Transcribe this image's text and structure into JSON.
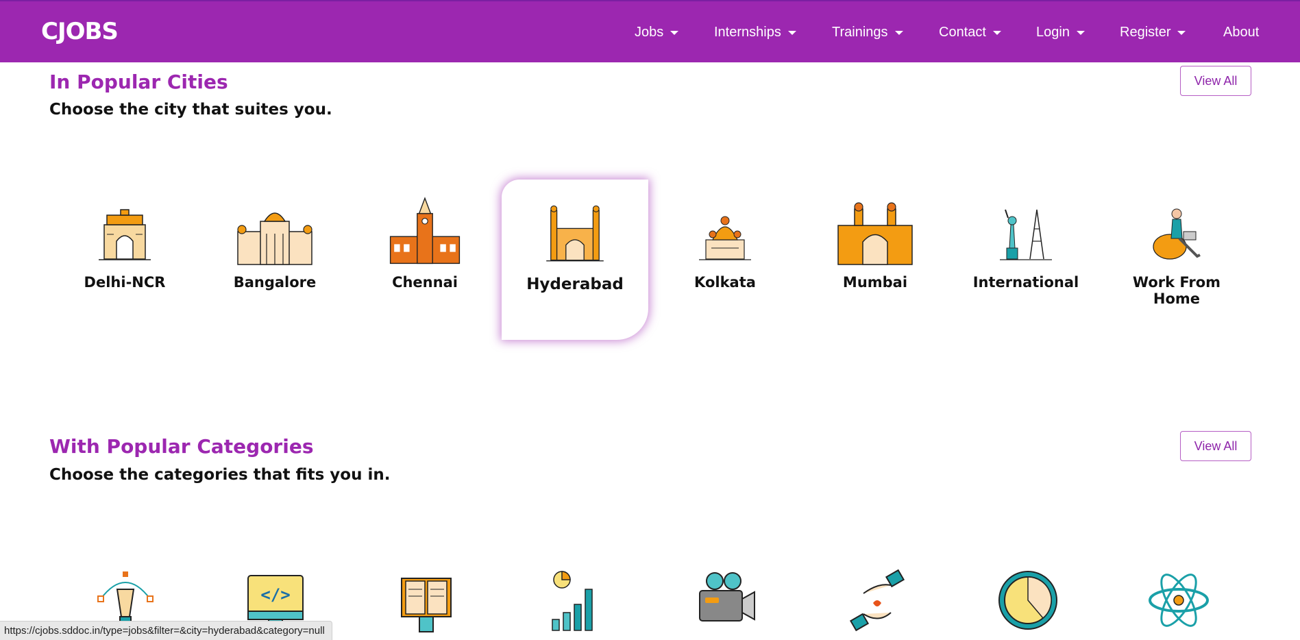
{
  "header": {
    "brand": "CJOBS",
    "nav": [
      {
        "label": "Jobs",
        "dropdown": true
      },
      {
        "label": "Internships",
        "dropdown": true
      },
      {
        "label": "Trainings",
        "dropdown": true
      },
      {
        "label": "Contact",
        "dropdown": true
      },
      {
        "label": "Login",
        "dropdown": true
      },
      {
        "label": "Register",
        "dropdown": true
      },
      {
        "label": "About",
        "dropdown": false
      }
    ]
  },
  "cities_section": {
    "title": "In Popular Cities",
    "subtitle": "Choose the city that suites you.",
    "view_all": "View All",
    "cities": [
      {
        "label": "Delhi-NCR",
        "icon": "india-gate-icon"
      },
      {
        "label": "Bangalore",
        "icon": "vidhana-soudha-icon"
      },
      {
        "label": "Chennai",
        "icon": "chennai-central-icon"
      },
      {
        "label": "Hyderabad",
        "icon": "charminar-icon",
        "active": true
      },
      {
        "label": "Kolkata",
        "icon": "dakshineswar-temple-icon"
      },
      {
        "label": "Mumbai",
        "icon": "gateway-of-india-icon"
      },
      {
        "label": "International",
        "icon": "liberty-eiffel-icon"
      },
      {
        "label": "Work From Home",
        "icon": "person-laptop-beanbag-icon"
      }
    ]
  },
  "categories_section": {
    "title": "With Popular Categories",
    "subtitle": "Choose the categories that fits you in.",
    "view_all": "View All",
    "icons": [
      "pen-tool-icon",
      "code-monitor-icon",
      "book-icon",
      "analytics-chart-icon",
      "video-camera-icon",
      "helping-hands-heart-icon",
      "clock-icon",
      "atom-icon"
    ]
  },
  "status_bar": {
    "url": "https://cjobs.sddoc.in/type=jobs&filter=&city=hyderabad&category=null"
  },
  "colors": {
    "brand": "#9c27b0",
    "icon_orange": "#f39c12",
    "icon_teal": "#1aa0a8"
  }
}
